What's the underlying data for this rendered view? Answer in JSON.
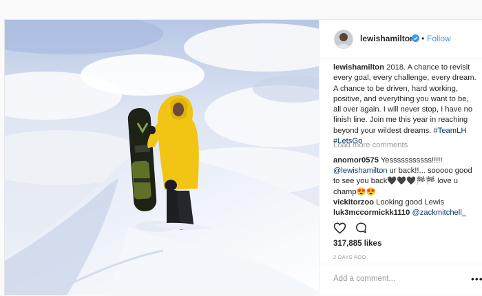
{
  "profile": {
    "username": "lewishamilton",
    "separator": "•",
    "follow_label": "Follow"
  },
  "caption": {
    "username": "lewishamilton",
    "text": " 2018. A chance to revisit every goal, every challenge, every dream. A chance to be driven, hard working, positive, and everything you want to be, all over again. I will never stop, I have no finish line. Join me this year in reaching beyond your wildest dreams. ",
    "tag1": "#TeamLH",
    "tag2": "#LetsGo"
  },
  "load_more": "Load more comments",
  "comments": [
    {
      "user": "anomor0575",
      "mention": "",
      "text": " Yesssssssssss!!!!!"
    },
    {
      "user": "",
      "mention": "@lewishamilton",
      "text": " ur back!!... sooooo good to see you back🖤🖤🖤🏁🏁 love u champ😍😍"
    },
    {
      "user": "vickitorzoo",
      "mention": "",
      "text": " Looking good Lewis"
    },
    {
      "user": "luk3mccormickk1110",
      "mention": "@zackmitchell_",
      "text": ""
    }
  ],
  "likes": "317,885 likes",
  "timestamp": "2 DAYS AGO",
  "add_comment_placeholder": "Add a comment...",
  "more_glyph": "•••",
  "colors": {
    "accent": "#3897f0",
    "link": "#003569",
    "jacket": "#f2c414"
  },
  "icons": [
    "verified-icon",
    "heart-icon",
    "comment-icon",
    "more-options-icon"
  ]
}
